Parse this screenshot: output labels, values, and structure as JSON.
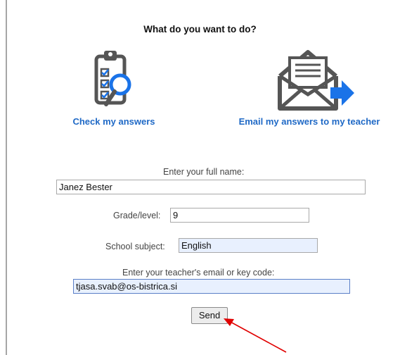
{
  "title": "What do you want to do?",
  "options": {
    "check": {
      "label": "Check my answers",
      "icon": "clipboard-magnifier-icon"
    },
    "email": {
      "label": "Email my answers to my teacher",
      "icon": "envelope-arrow-icon"
    }
  },
  "form": {
    "name_label": "Enter your full name:",
    "name_value": "Janez Bester",
    "grade_label": "Grade/level:",
    "grade_value": "9",
    "subject_label": "School subject:",
    "subject_value": "English",
    "email_label": "Enter your teacher's email or key code:",
    "email_value": "tjasa.svab@os-bistrica.si",
    "send_label": "Send"
  },
  "colors": {
    "link": "#1f69c6",
    "icon_dark": "#555555",
    "icon_blue": "#1a73e8",
    "annotation_arrow": "#e00000",
    "autofill": "#e8f0fe"
  }
}
